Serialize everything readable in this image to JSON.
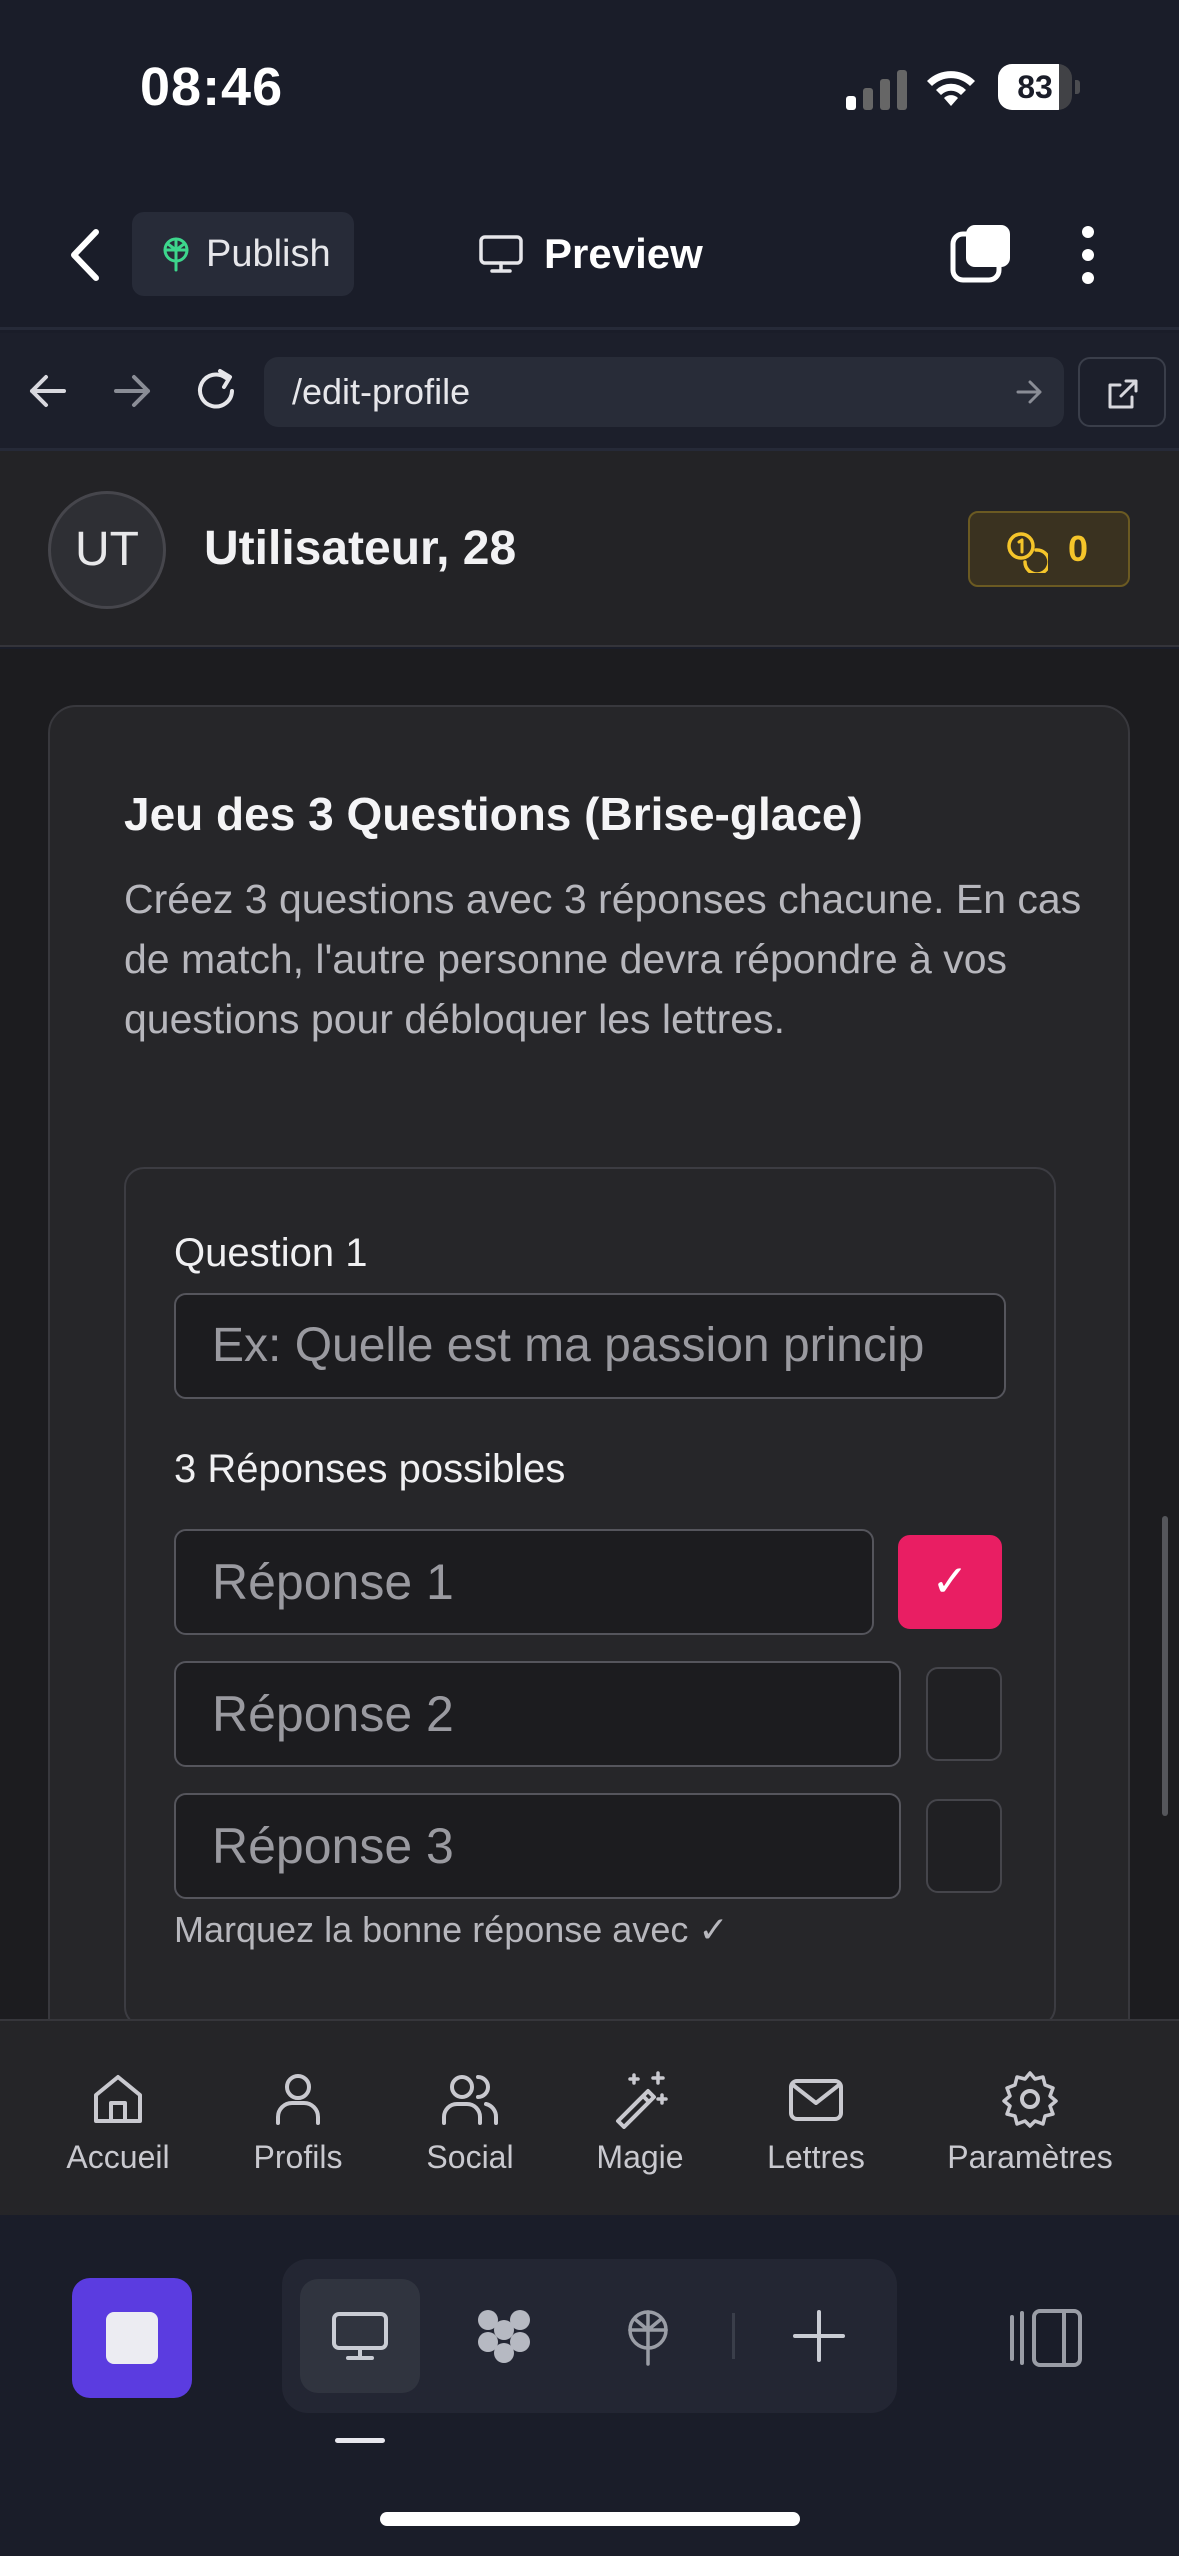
{
  "status": {
    "time": "08:46",
    "battery": "83",
    "battery_level": 0.83
  },
  "header": {
    "publish_label": "Publish",
    "preview_label": "Preview"
  },
  "browser": {
    "url": "/edit-profile"
  },
  "profile": {
    "initials": "UT",
    "name": "Utilisateur, 28",
    "coins": "0"
  },
  "card": {
    "title": "Jeu des 3 Questions (Brise-glace)",
    "description": "Créez 3 questions avec 3 réponses chacune. En cas de match, l'autre personne devra répondre à vos questions pour débloquer les lettres.",
    "question_label": "Question 1",
    "question_placeholder": "Ex: Quelle est ma passion princip",
    "answers_label": "3 Réponses possibles",
    "answers": [
      {
        "placeholder": "Réponse 1",
        "correct": true
      },
      {
        "placeholder": "Réponse 2",
        "correct": false
      },
      {
        "placeholder": "Réponse 3",
        "correct": false
      }
    ],
    "check_mark": "✓",
    "hint": "Marquez la bonne réponse avec ✓"
  },
  "tabs": [
    {
      "label": "Accueil",
      "icon": "home-icon"
    },
    {
      "label": "Profils",
      "icon": "user-icon"
    },
    {
      "label": "Social",
      "icon": "users-icon"
    },
    {
      "label": "Magie",
      "icon": "magic-wand-icon"
    },
    {
      "label": "Lettres",
      "icon": "mail-icon"
    },
    {
      "label": "Paramètres",
      "icon": "gear-icon"
    }
  ],
  "colors": {
    "accent_pink": "#e91e63",
    "stop_purple": "#5b3ce0",
    "coin_gold": "#f5c52a"
  }
}
